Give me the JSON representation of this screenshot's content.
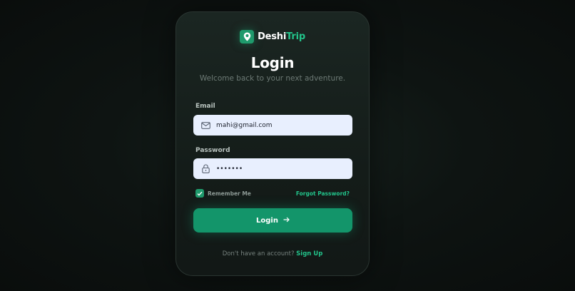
{
  "brand": {
    "name_part1": "Deshi",
    "name_part2": "Trip",
    "accent_color": "#22c38a"
  },
  "heading": {
    "title": "Login",
    "subtitle": "Welcome back to your next adventure."
  },
  "form": {
    "email": {
      "label": "Email",
      "value": "mahi@gmail.com",
      "icon": "mail-icon"
    },
    "password": {
      "label": "Password",
      "value": "•••••••",
      "icon": "lock-icon"
    },
    "remember": {
      "label": "Remember Me",
      "checked": true
    },
    "forgot_label": "Forgot Password?",
    "submit_label": "Login"
  },
  "footer": {
    "question": "Don't have an account?",
    "signup_label": "Sign Up"
  }
}
